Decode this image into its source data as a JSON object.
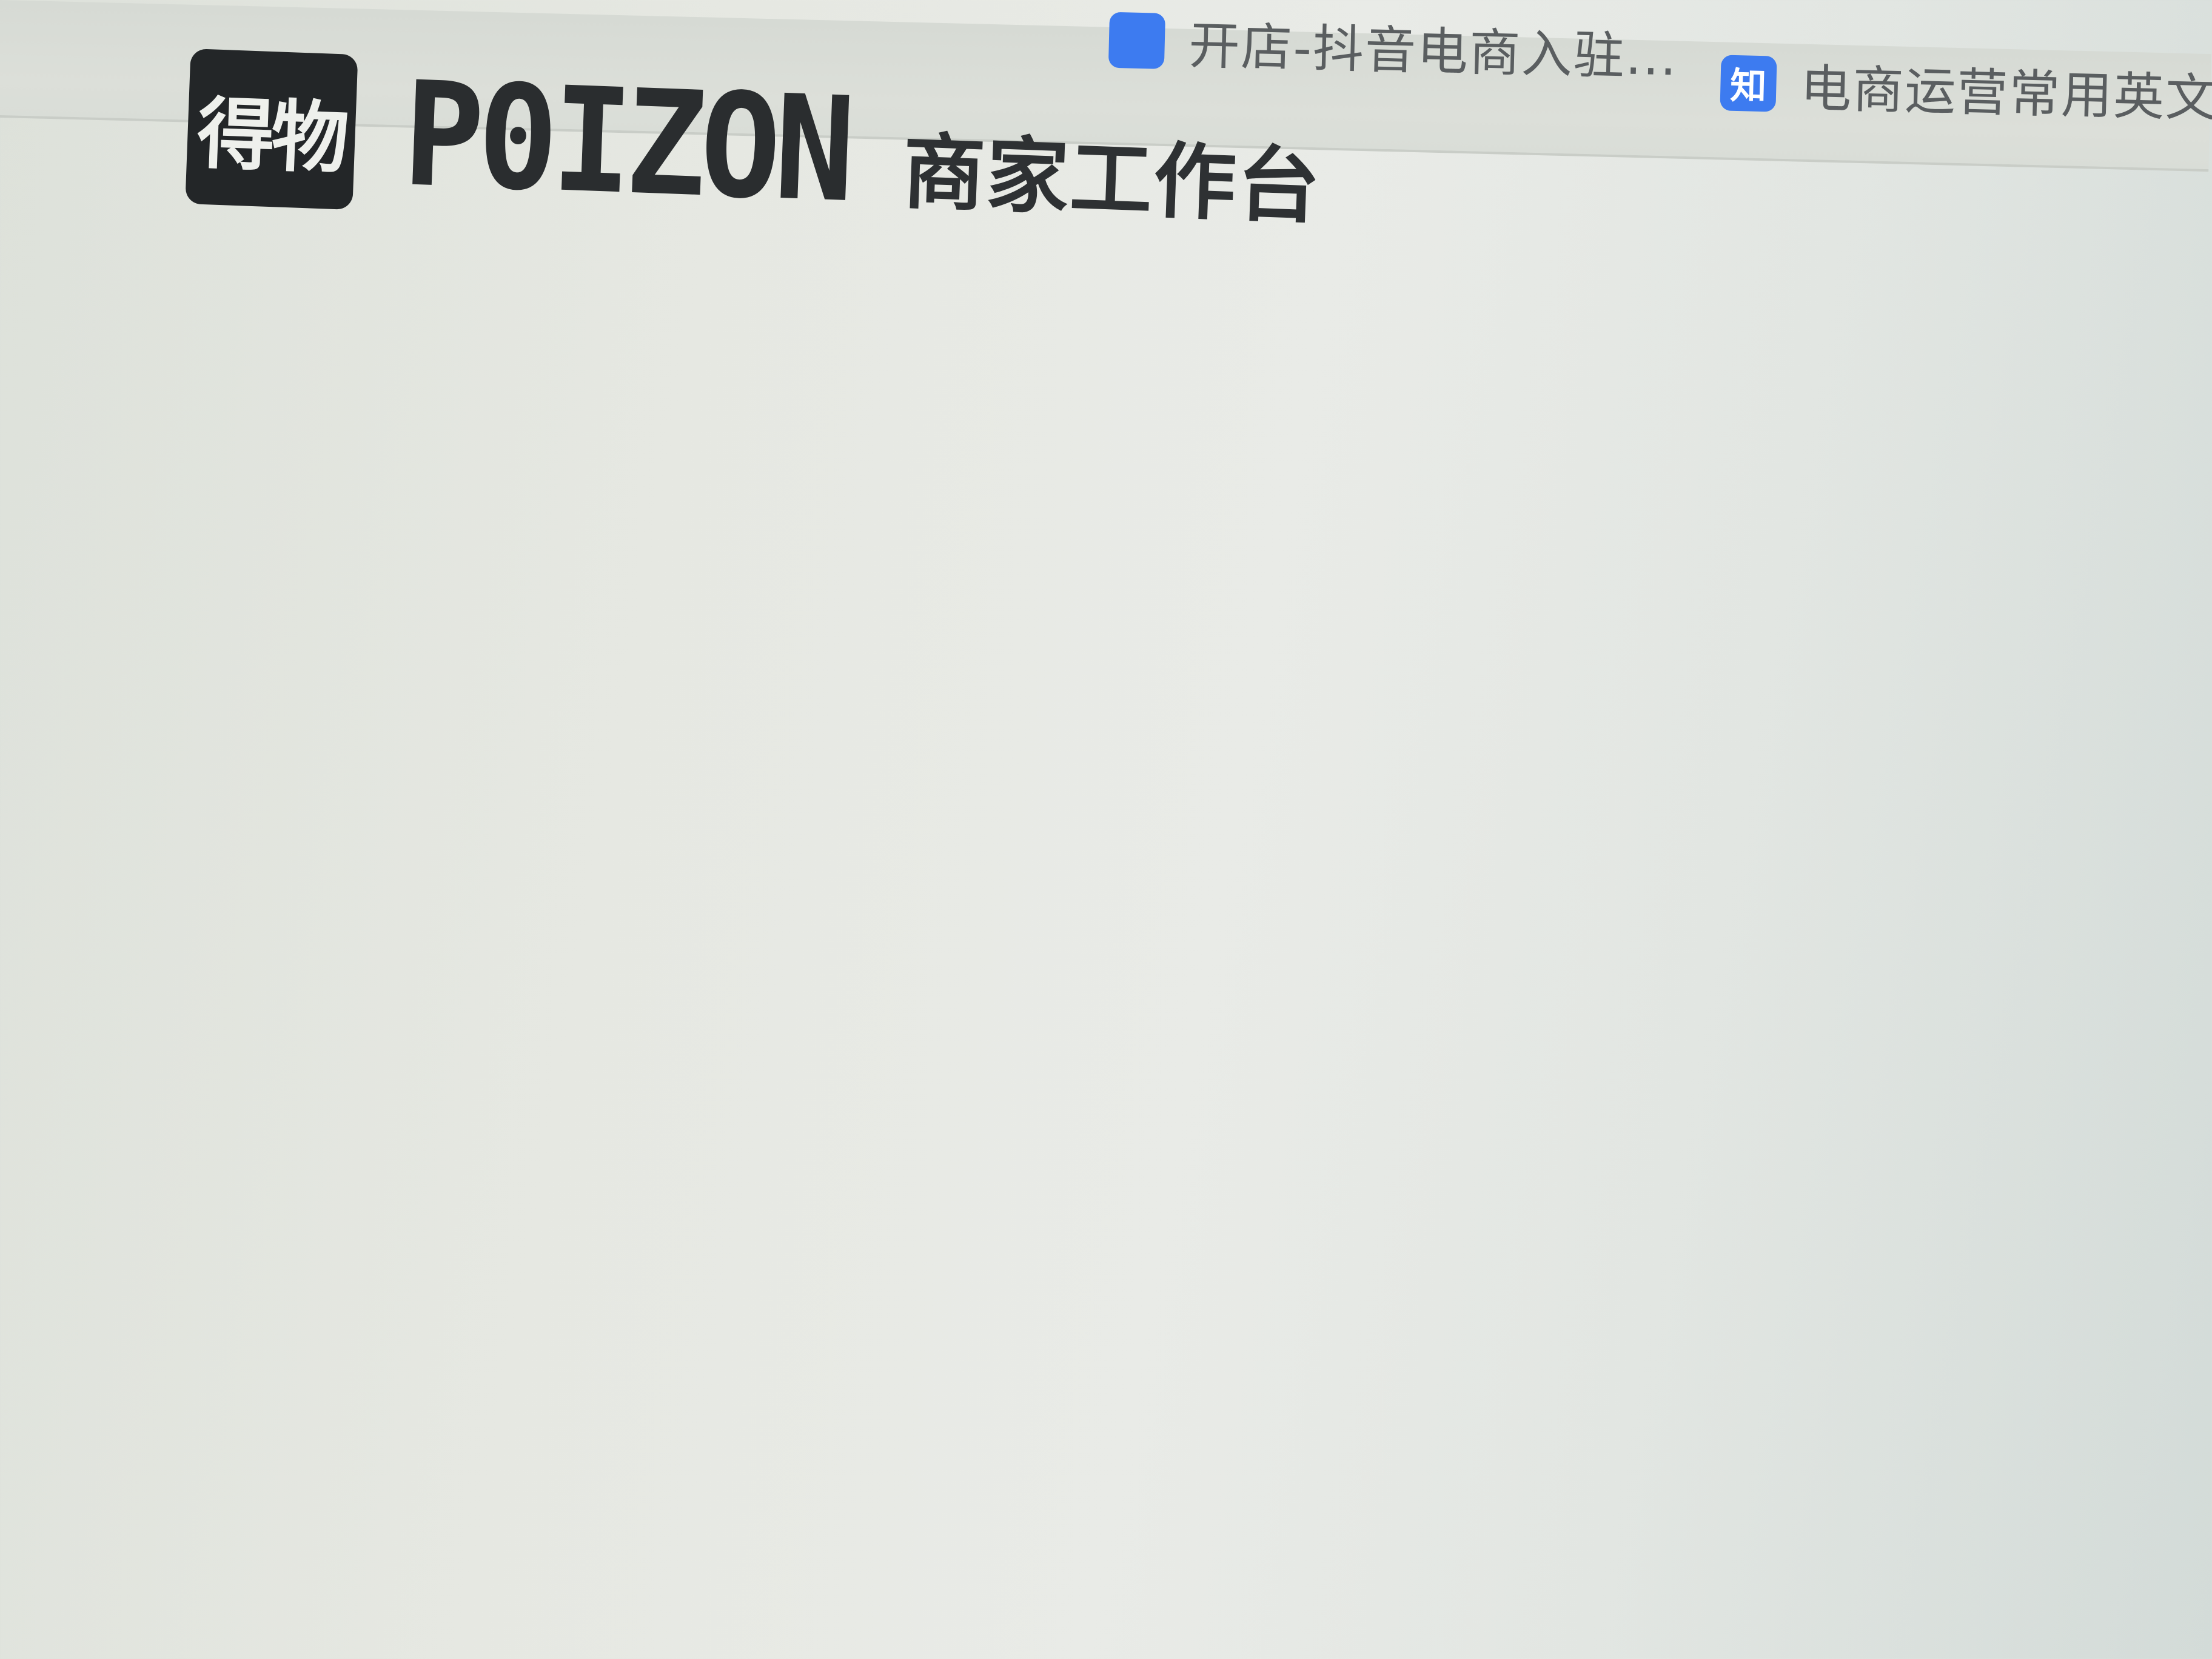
{
  "bookmarks": [
    {
      "icon": "",
      "label": "开店-抖音电商入驻..."
    },
    {
      "icon": "知",
      "label": "电商运营常用英文..."
    }
  ],
  "header": {
    "logo_glyph": "得物",
    "brand_name": "P0IZON",
    "portal_title": "商家工作台"
  },
  "colors": {
    "bookmark_icon": "#3d7bf0",
    "logo_bg": "#232628",
    "text_dark": "#2a2d2f",
    "page_bg": "#e6e8e2"
  }
}
